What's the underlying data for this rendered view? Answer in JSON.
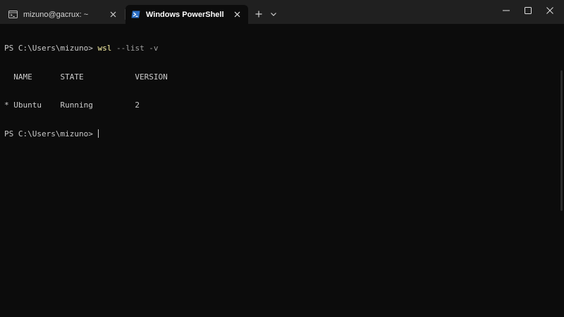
{
  "tabs": [
    {
      "title": "mizuno@gacrux: ~",
      "icon": "terminal-icon",
      "active": false
    },
    {
      "title": "Windows PowerShell",
      "icon": "powershell-icon",
      "active": true
    }
  ],
  "tabbar": {
    "new_tab_icon": "plus-icon",
    "dropdown_icon": "chevron-down-icon"
  },
  "window_controls": [
    "minimize-icon",
    "maximize-icon",
    "close-icon"
  ],
  "terminal": {
    "prompt": "PS C:\\Users\\mizuno> ",
    "command": "wsl",
    "args": " --list -v",
    "table_header": "  NAME      STATE           VERSION",
    "table_rows": [
      "* Ubuntu    Running         2"
    ],
    "prompt_2": "PS C:\\Users\\mizuno> "
  },
  "colors": {
    "background": "#0c0c0c",
    "titlebar": "#202020",
    "command": "#f9f1a5",
    "text": "#cccccc"
  }
}
